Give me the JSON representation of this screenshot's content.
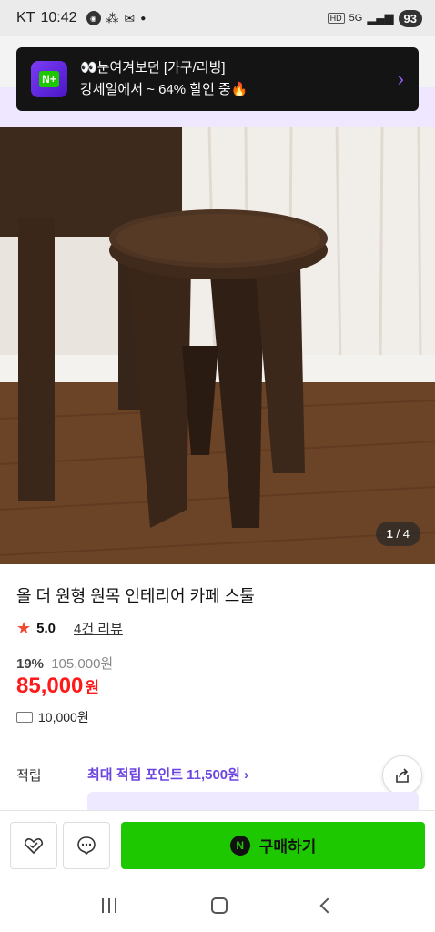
{
  "status_bar": {
    "carrier": "KT",
    "time": "10:42",
    "signal_label": "5G",
    "battery": "93"
  },
  "toast": {
    "logo_text": "N+",
    "line1": "👀눈여겨보던 [가구/리빙]",
    "line2": "강세일에서 ~ 64% 할인 중🔥"
  },
  "image_counter": {
    "current": "1",
    "total": "/ 4"
  },
  "product": {
    "title": "올 더 원형 원목 인테리어 카페 스툴",
    "rating": "5.0",
    "review_count": "4건 리뷰",
    "discount_pct": "19%",
    "original_price": "105,000원",
    "price": "85,000",
    "price_unit": "원",
    "shipping_fee": "10,000원"
  },
  "points": {
    "label": "적립",
    "max_points": "최대 적립 포인트 11,500원 ›"
  },
  "action_bar": {
    "buy_label": "구매하기",
    "npay_text": "N"
  },
  "colors": {
    "accent_green": "#1ec800",
    "price_red": "#ff1a1a",
    "points_purple": "#6b45e0"
  }
}
